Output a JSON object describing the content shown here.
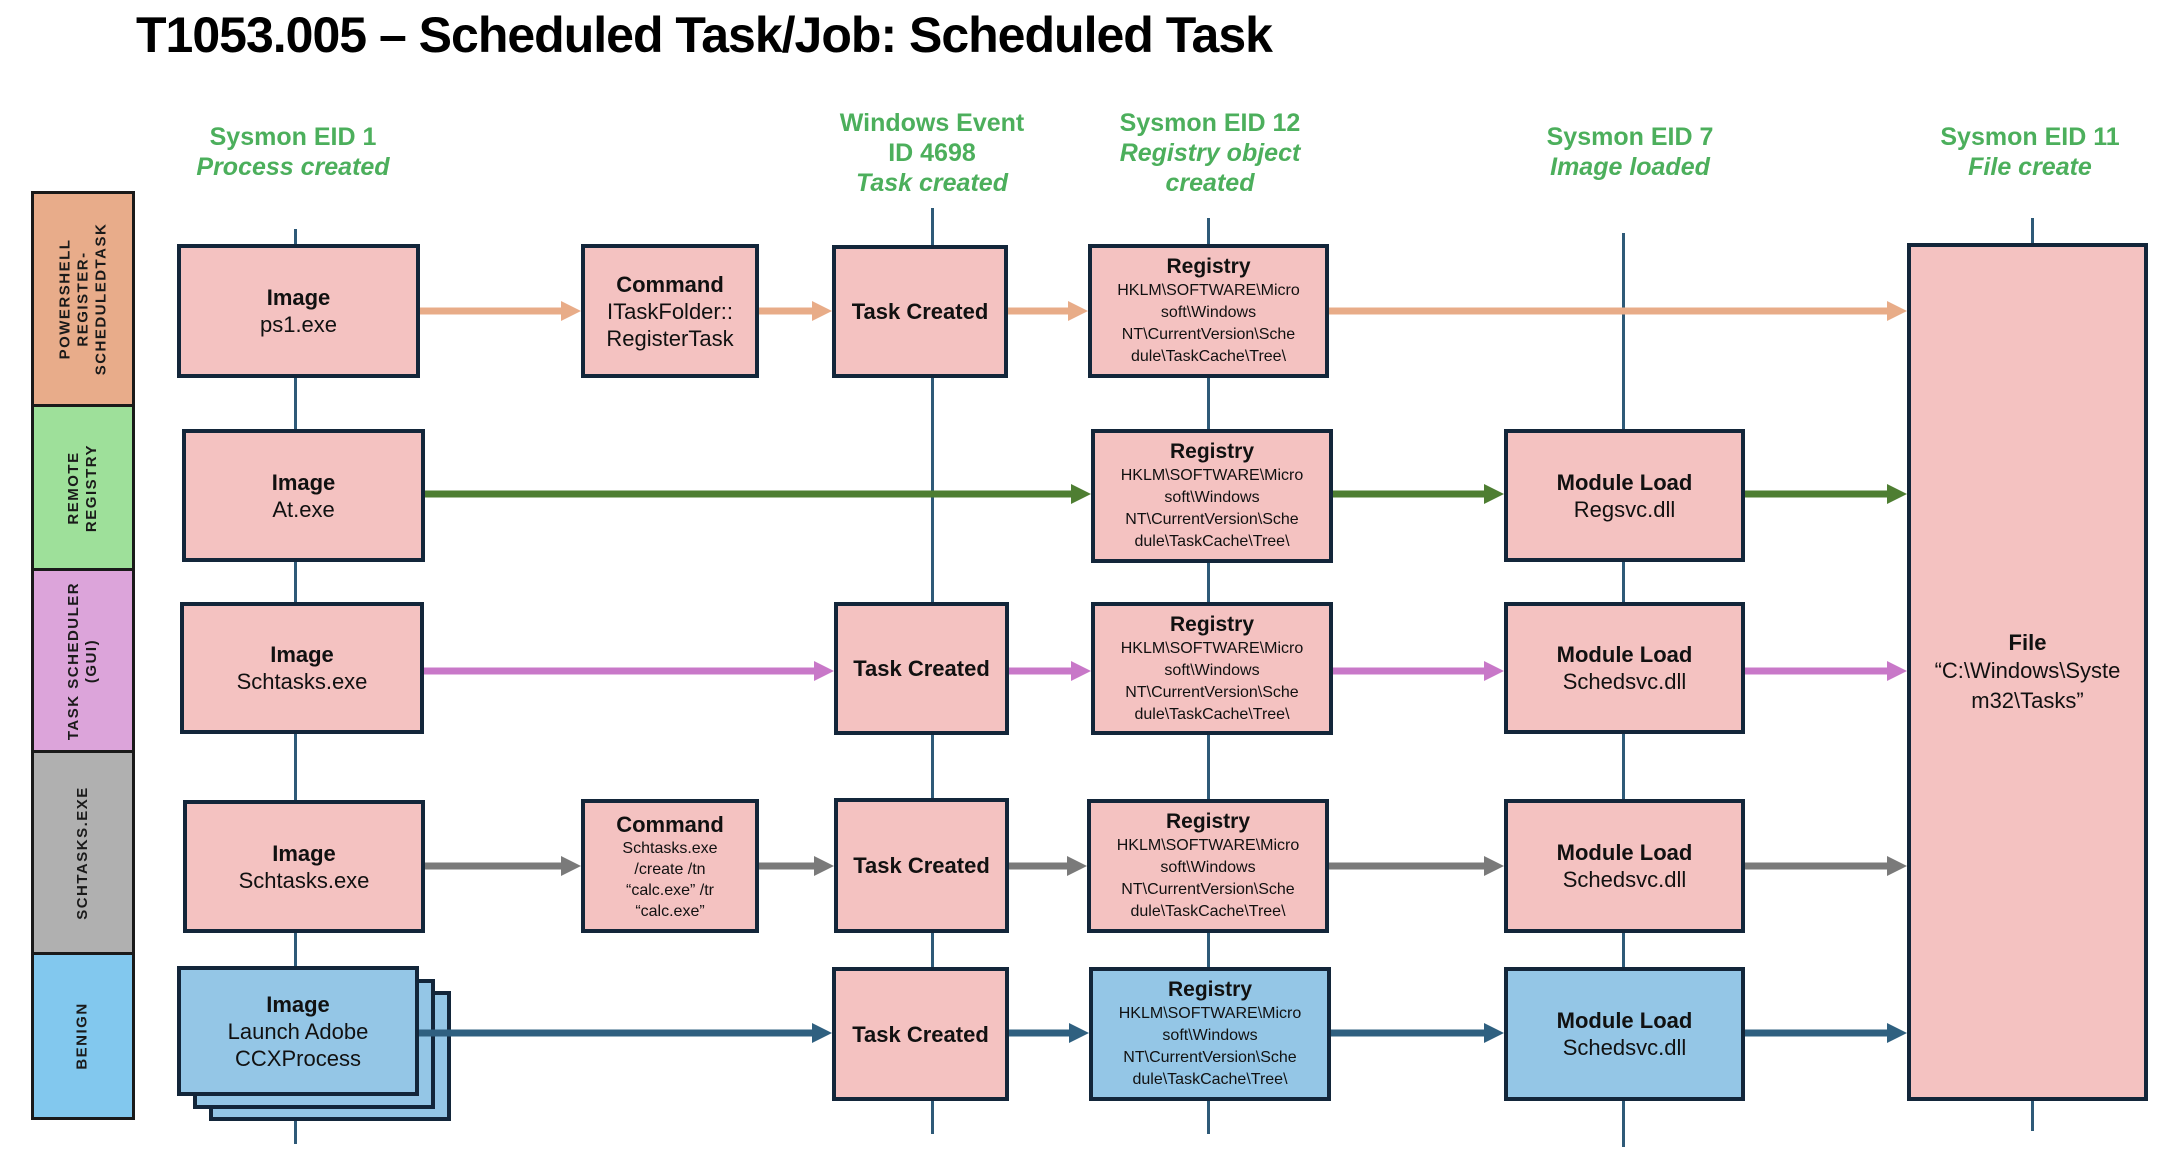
{
  "title": "T1053.005 – Scheduled Task/Job: Scheduled Task",
  "columns": [
    {
      "id": "eid1",
      "lines": [
        "Sysmon EID 1"
      ],
      "sub": [
        "Process created"
      ]
    },
    {
      "id": "evt4698",
      "lines": [
        "Windows Event",
        "ID 4698"
      ],
      "sub": [
        "Task created"
      ]
    },
    {
      "id": "eid12",
      "lines": [
        "Sysmon EID 12"
      ],
      "sub": [
        "Registry object",
        "created"
      ]
    },
    {
      "id": "eid7",
      "lines": [
        "Sysmon EID 7"
      ],
      "sub": [
        "Image loaded"
      ]
    },
    {
      "id": "eid11",
      "lines": [
        "Sysmon EID 11"
      ],
      "sub": [
        "File create"
      ]
    }
  ],
  "lanes": [
    {
      "label": "POWERSHELL\nREGISTER-\nSCHEDULEDTASK",
      "color": "#e8ac8a",
      "arrow_color": "#e8ac88"
    },
    {
      "label": "REMOTE\nREGISTRY",
      "color": "#9ee09a",
      "arrow_color": "#4e7e32"
    },
    {
      "label": "TASK SCHEDULER\n(GUI)",
      "color": "#dca4da",
      "arrow_color": "#c878c8"
    },
    {
      "label": "SCHTASKS.EXE",
      "color": "#b0b0b0",
      "arrow_color": "#7a7a7a"
    },
    {
      "label": "BENIGN",
      "color": "#82c8ee",
      "arrow_color": "#2f6080"
    }
  ],
  "nodes": {
    "r1_image": {
      "head": "Image",
      "body": "ps1.exe"
    },
    "r1_cmd": {
      "head": "Command",
      "body": "ITaskFolder::\nRegisterTask"
    },
    "r1_task": {
      "head": "Task Created",
      "body": ""
    },
    "r1_reg": {
      "head": "Registry",
      "body": "HKLM\\SOFTWARE\\Micro\nsoft\\Windows\nNT\\CurrentVersion\\Sche\ndule\\TaskCache\\Tree\\"
    },
    "r2_image": {
      "head": "Image",
      "body": "At.exe"
    },
    "r2_reg": {
      "head": "Registry",
      "body": "HKLM\\SOFTWARE\\Micro\nsoft\\Windows\nNT\\CurrentVersion\\Sche\ndule\\TaskCache\\Tree\\"
    },
    "r2_mod": {
      "head": "Module Load",
      "body": "Regsvc.dll"
    },
    "r3_image": {
      "head": "Image",
      "body": "Schtasks.exe"
    },
    "r3_task": {
      "head": "Task Created",
      "body": ""
    },
    "r3_reg": {
      "head": "Registry",
      "body": "HKLM\\SOFTWARE\\Micro\nsoft\\Windows\nNT\\CurrentVersion\\Sche\ndule\\TaskCache\\Tree\\"
    },
    "r3_mod": {
      "head": "Module Load",
      "body": "Schedsvc.dll"
    },
    "r4_image": {
      "head": "Image",
      "body": "Schtasks.exe"
    },
    "r4_cmd": {
      "head": "Command",
      "body": "Schtasks.exe\n/create /tn\n“calc.exe” /tr\n“calc.exe”"
    },
    "r4_task": {
      "head": "Task Created",
      "body": ""
    },
    "r4_reg": {
      "head": "Registry",
      "body": "HKLM\\SOFTWARE\\Micro\nsoft\\Windows\nNT\\CurrentVersion\\Sche\ndule\\TaskCache\\Tree\\"
    },
    "r4_mod": {
      "head": "Module Load",
      "body": "Schedsvc.dll"
    },
    "r5_image": {
      "head": "Image",
      "body": "Launch Adobe\nCCXProcess"
    },
    "r5_task": {
      "head": "Task Created",
      "body": ""
    },
    "r5_reg": {
      "head": "Registry",
      "body": "HKLM\\SOFTWARE\\Micro\nsoft\\Windows\nNT\\CurrentVersion\\Sche\ndule\\TaskCache\\Tree\\"
    },
    "r5_mod": {
      "head": "Module Load",
      "body": "Schedsvc.dll"
    },
    "file": {
      "head": "File",
      "body": "“C:\\Windows\\Syste\nm32\\Tasks”"
    }
  },
  "connections": [
    {
      "lane": 0,
      "from": "r1_image",
      "to": "r1_cmd"
    },
    {
      "lane": 0,
      "from": "r1_cmd",
      "to": "r1_task"
    },
    {
      "lane": 0,
      "from": "r1_task",
      "to": "r1_reg"
    },
    {
      "lane": 0,
      "from": "r1_reg",
      "to": "file"
    },
    {
      "lane": 1,
      "from": "r2_image",
      "to": "r2_reg"
    },
    {
      "lane": 1,
      "from": "r2_reg",
      "to": "r2_mod"
    },
    {
      "lane": 1,
      "from": "r2_mod",
      "to": "file"
    },
    {
      "lane": 2,
      "from": "r3_image",
      "to": "r3_task"
    },
    {
      "lane": 2,
      "from": "r3_task",
      "to": "r3_reg"
    },
    {
      "lane": 2,
      "from": "r3_reg",
      "to": "r3_mod"
    },
    {
      "lane": 2,
      "from": "r3_mod",
      "to": "file"
    },
    {
      "lane": 3,
      "from": "r4_image",
      "to": "r4_cmd"
    },
    {
      "lane": 3,
      "from": "r4_cmd",
      "to": "r4_task"
    },
    {
      "lane": 3,
      "from": "r4_task",
      "to": "r4_reg"
    },
    {
      "lane": 3,
      "from": "r4_reg",
      "to": "r4_mod"
    },
    {
      "lane": 3,
      "from": "r4_mod",
      "to": "file"
    },
    {
      "lane": 4,
      "from": "r5_image",
      "to": "r5_task"
    },
    {
      "lane": 4,
      "from": "r5_task",
      "to": "r5_reg"
    },
    {
      "lane": 4,
      "from": "r5_reg",
      "to": "r5_mod"
    },
    {
      "lane": 4,
      "from": "r5_mod",
      "to": "file"
    }
  ],
  "colors": {
    "header_green": "#4caf5c",
    "box_malicious": "#f4c2c1",
    "box_benign": "#94c6e6",
    "box_border": "#13263a",
    "timeline": "#2e5a78"
  }
}
